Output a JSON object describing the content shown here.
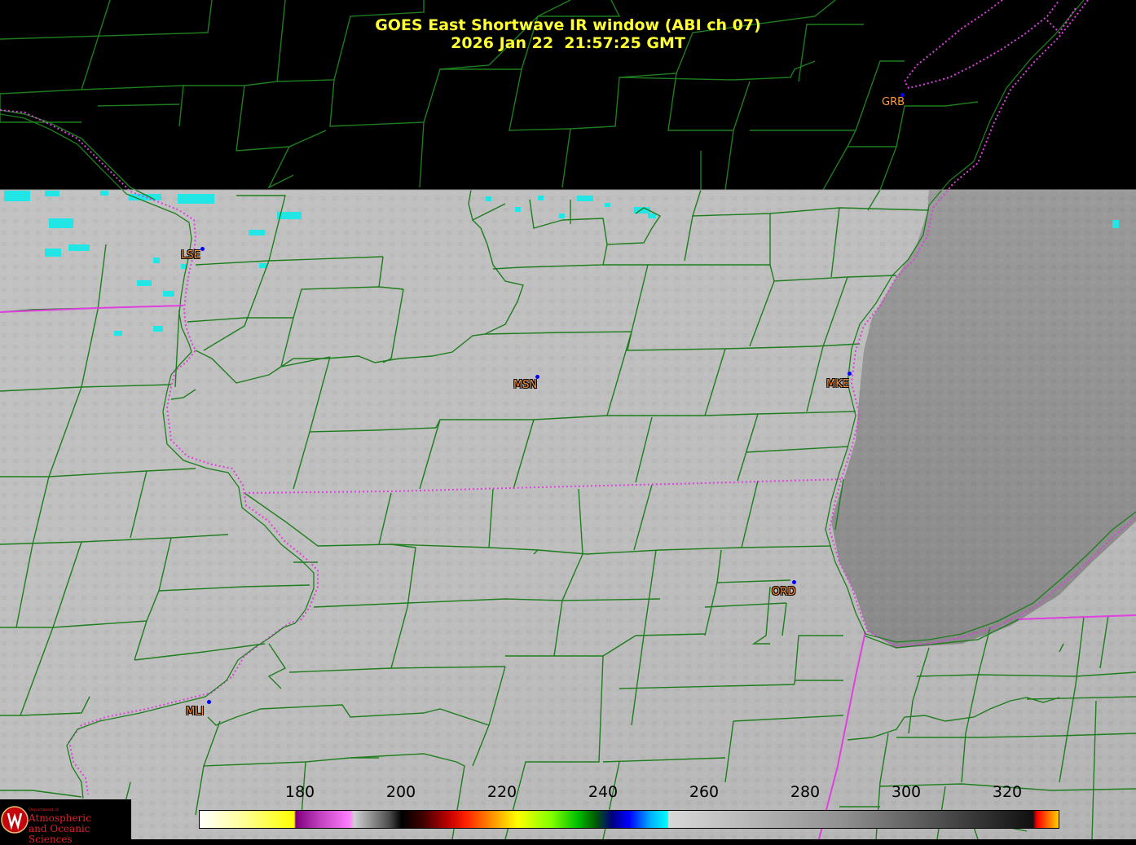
{
  "title": {
    "line1": "GOES East Shortwave IR window (ABI ch 07)",
    "line2": "2026 Jan 22  21:57:25 GMT"
  },
  "stations": [
    {
      "id": "grb",
      "label": "GRB"
    },
    {
      "id": "lse",
      "label": "LSE"
    },
    {
      "id": "msn",
      "label": "MSN"
    },
    {
      "id": "mke",
      "label": "MKE"
    },
    {
      "id": "ord",
      "label": "ORD"
    },
    {
      "id": "mli",
      "label": "MLI"
    }
  ],
  "colorbar": {
    "min": 160,
    "max": 330,
    "ticks": [
      "180",
      "200",
      "220",
      "240",
      "260",
      "280",
      "300",
      "320"
    ]
  },
  "logo": {
    "small": "Department of",
    "line1": "Atmospheric",
    "line2": "and Oceanic Sciences"
  },
  "colors": {
    "title": "#ffff33",
    "county_lines": "#1e7d1e",
    "state_lines": "#e040e0",
    "station_label": "#ff9a3a",
    "station_dot": "#0000ff",
    "cold_cloud": "#22e6e6"
  }
}
